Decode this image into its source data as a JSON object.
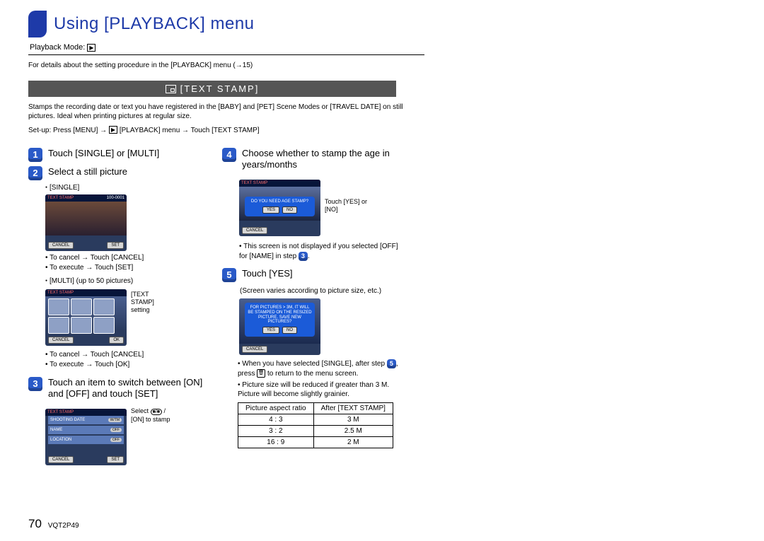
{
  "title": "Using [PLAYBACK] menu",
  "mode_label": "Playback Mode:",
  "mode_symbol": "▶",
  "details_line": "For details about the setting procedure in the [PLAYBACK] menu (→15)",
  "section_header": "[TEXT STAMP]",
  "intro": "Stamps the recording date or text you have registered in the [BABY] and [PET] Scene Modes or [TRAVEL DATE] on still pictures. Ideal when printing pictures at regular size.",
  "setup_prefix": "Set-up: Press [MENU] → ",
  "setup_mid": " [PLAYBACK] menu → Touch [TEXT STAMP]",
  "left": {
    "step1": "Touch [SINGLE] or [MULTI]",
    "step2": "Select a still picture",
    "single_lbl": "[SINGLE]",
    "s1_cancel": "To cancel → Touch [CANCEL]",
    "s1_set": "To execute → Touch [SET]",
    "multi_lbl": "[MULTI] (up to 50 pictures)",
    "multi_side": "[TEXT STAMP] setting",
    "m_cancel": "To cancel → Touch [CANCEL]",
    "m_ok": "To execute → Touch [OK]",
    "step3": "Touch an item to switch between [ON] and [OFF] and touch [SET]",
    "s3_side1": "Select",
    "s3_side2": "/ [ON] to stamp",
    "ss3": {
      "top": "TEXT STAMP",
      "r1": "SHOOTING DATE",
      "r2": "NAME",
      "r3": "LOCATION",
      "cancel": "CANCEL",
      "set": "SET"
    },
    "ss1": {
      "top": "TEXT STAMP",
      "hdr": "100-0001",
      "cancel": "CANCEL",
      "set": "SET"
    },
    "ss2": {
      "top": "TEXT STAMP",
      "cancel": "CANCEL",
      "ok": "OK"
    }
  },
  "right": {
    "step4": "Choose whether to stamp the age in years/months",
    "ss4": {
      "top": "TEXT STAMP",
      "q": "DO YOU NEED AGE STAMP?",
      "yes": "YES",
      "no": "NO",
      "cancel": "CANCEL"
    },
    "s4_side": "Touch [YES] or [NO]",
    "s4_note_a": "This screen is not displayed if you selected [OFF] for [NAME] in step ",
    "s4_note_b": ".",
    "step5": "Touch [YES]",
    "s5_sub": "(Screen varies according to picture size, etc.)",
    "ss5": {
      "txt": "FOR PICTURES > 3M, IT WILL BE STAMPED ON THE RESIZED PICTURE. SAVE NEW PICTURES?",
      "yes": "YES",
      "no": "NO",
      "cancel": "CANCEL"
    },
    "bullet1a": "When you have selected [SINGLE], after step ",
    "bullet1b": ", press ",
    "bullet1c": " to return to the menu screen.",
    "bullet2": "Picture size will be reduced if greater than 3 M. Picture will become slightly grainier.",
    "table": {
      "h1": "Picture aspect ratio",
      "h2": "After [TEXT STAMP]",
      "rows": [
        [
          "4 : 3",
          "3 M"
        ],
        [
          "3 : 2",
          "2.5 M"
        ],
        [
          "16 : 9",
          "2 M"
        ]
      ]
    }
  },
  "footer_page": "70",
  "footer_code": "VQT2P49"
}
